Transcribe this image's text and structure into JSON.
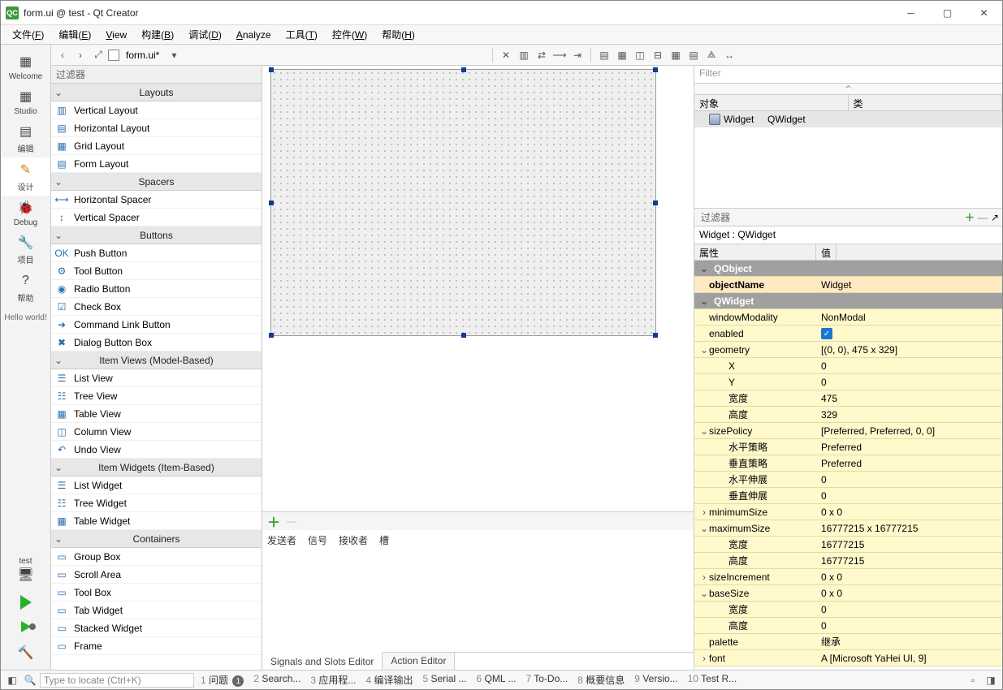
{
  "title": "form.ui @ test - Qt Creator",
  "menu": [
    "文件(F)",
    "编辑(E)",
    "View",
    "构建(B)",
    "调试(D)",
    "Analyze",
    "工具(T)",
    "控件(W)",
    "帮助(H)"
  ],
  "leftrail": {
    "items": [
      {
        "label": "Welcome",
        "icon": "grid"
      },
      {
        "label": "Studio",
        "icon": "grid"
      },
      {
        "label": "编辑",
        "icon": "doc"
      },
      {
        "label": "设计",
        "icon": "pencil"
      },
      {
        "label": "Debug",
        "icon": "bug"
      },
      {
        "label": "项目",
        "icon": "wrench"
      },
      {
        "label": "帮助",
        "icon": "help"
      }
    ],
    "hello": "Hello world!",
    "project": "test"
  },
  "subToolbar": {
    "file": "form.ui*"
  },
  "widgetbox": {
    "filter": "过滤器",
    "cats": [
      {
        "label": "Layouts",
        "items": [
          "Vertical Layout",
          "Horizontal Layout",
          "Grid Layout",
          "Form Layout"
        ]
      },
      {
        "label": "Spacers",
        "items": [
          "Horizontal Spacer",
          "Vertical Spacer"
        ]
      },
      {
        "label": "Buttons",
        "items": [
          "Push Button",
          "Tool Button",
          "Radio Button",
          "Check Box",
          "Command Link Button",
          "Dialog Button Box"
        ]
      },
      {
        "label": "Item Views (Model-Based)",
        "items": [
          "List View",
          "Tree View",
          "Table View",
          "Column View",
          "Undo View"
        ]
      },
      {
        "label": "Item Widgets (Item-Based)",
        "items": [
          "List Widget",
          "Tree Widget",
          "Table Widget"
        ]
      },
      {
        "label": "Containers",
        "items": [
          "Group Box",
          "Scroll Area",
          "Tool Box",
          "Tab Widget",
          "Stacked Widget",
          "Frame"
        ]
      }
    ]
  },
  "sigslot": {
    "cols": [
      "发送者",
      "信号",
      "接收者",
      "槽"
    ],
    "tabs": [
      "Signals and Slots Editor",
      "Action Editor"
    ]
  },
  "objInspector": {
    "filter": "Filter",
    "cols": [
      "对象",
      "类"
    ],
    "row": {
      "obj": "Widget",
      "cls": "QWidget"
    }
  },
  "propEditor": {
    "filter": "过滤器",
    "title": "Widget : QWidget",
    "cols": [
      "属性",
      "值"
    ],
    "groups": [
      {
        "class": "QObject",
        "rows": [
          {
            "k": "objectName",
            "v": "Widget",
            "bold": true
          }
        ]
      },
      {
        "class": "QWidget",
        "rows": [
          {
            "k": "windowModality",
            "v": "NonModal"
          },
          {
            "k": "enabled",
            "v": "__check__"
          },
          {
            "k": "geometry",
            "v": "[(0, 0), 475 x 329]",
            "exp": true,
            "children": [
              {
                "k": "X",
                "v": "0"
              },
              {
                "k": "Y",
                "v": "0"
              },
              {
                "k": "宽度",
                "v": "475"
              },
              {
                "k": "高度",
                "v": "329"
              }
            ]
          },
          {
            "k": "sizePolicy",
            "v": "[Preferred, Preferred, 0, 0]",
            "exp": true,
            "children": [
              {
                "k": "水平策略",
                "v": "Preferred"
              },
              {
                "k": "垂直策略",
                "v": "Preferred"
              },
              {
                "k": "水平伸展",
                "v": "0"
              },
              {
                "k": "垂直伸展",
                "v": "0"
              }
            ]
          },
          {
            "k": "minimumSize",
            "v": "0 x 0",
            "exp": false
          },
          {
            "k": "maximumSize",
            "v": "16777215 x 16777215",
            "exp": true,
            "children": [
              {
                "k": "宽度",
                "v": "16777215"
              },
              {
                "k": "高度",
                "v": "16777215"
              }
            ]
          },
          {
            "k": "sizeIncrement",
            "v": "0 x 0",
            "exp": false
          },
          {
            "k": "baseSize",
            "v": "0 x 0",
            "exp": true,
            "children": [
              {
                "k": "宽度",
                "v": "0"
              },
              {
                "k": "高度",
                "v": "0"
              }
            ]
          },
          {
            "k": "palette",
            "v": "继承"
          },
          {
            "k": "font",
            "v": "A  [Microsoft YaHei UI, 9]",
            "exp": false
          }
        ]
      }
    ]
  },
  "status": {
    "placeholder": "Type to locate (Ctrl+K)",
    "outputs": [
      {
        "n": "1",
        "t": "问题",
        "badge": "1"
      },
      {
        "n": "2",
        "t": "Search..."
      },
      {
        "n": "3",
        "t": "应用程..."
      },
      {
        "n": "4",
        "t": "编译输出"
      },
      {
        "n": "5",
        "t": "Serial ..."
      },
      {
        "n": "6",
        "t": "QML ..."
      },
      {
        "n": "7",
        "t": "To-Do..."
      },
      {
        "n": "8",
        "t": "概要信息"
      },
      {
        "n": "9",
        "t": "Versio..."
      },
      {
        "n": "10",
        "t": "Test R..."
      }
    ]
  }
}
